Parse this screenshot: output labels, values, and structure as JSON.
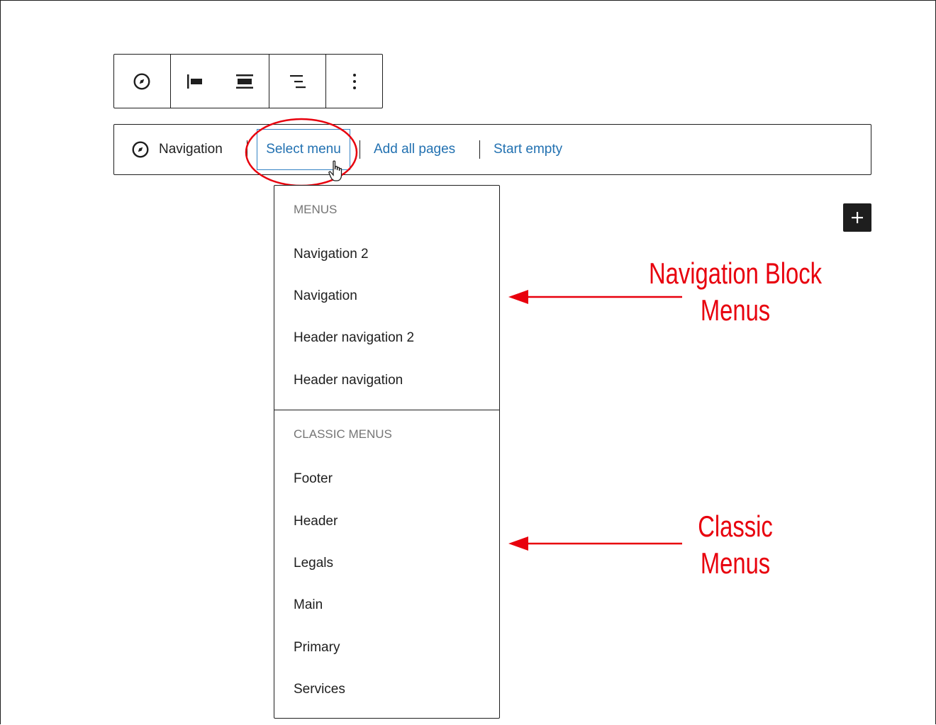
{
  "toolbar": {
    "buttons": [
      {
        "icon": "compass-icon",
        "label": "Navigation"
      },
      {
        "icon": "justify-left-icon",
        "label": "Justify items left"
      },
      {
        "icon": "justify-center-icon",
        "label": "Justify items center"
      },
      {
        "icon": "submenu-align-icon",
        "label": "Justify text"
      },
      {
        "icon": "more-options-icon",
        "label": "Options"
      }
    ]
  },
  "placeholder": {
    "block_label": "Navigation",
    "select_menu": "Select menu",
    "add_all_pages": "Add all pages",
    "start_empty": "Start empty"
  },
  "dropdown": {
    "menus_heading": "MENUS",
    "menus": [
      "Navigation 2",
      "Navigation",
      "Header navigation 2",
      "Header navigation"
    ],
    "classic_heading": "CLASSIC MENUS",
    "classic": [
      "Footer",
      "Header",
      "Legals",
      "Main",
      "Primary",
      "Services"
    ]
  },
  "annotations": {
    "nav_block_line1": "Navigation Block",
    "nav_block_line2": "Menus",
    "classic_line1": "Classic",
    "classic_line2": "Menus",
    "color": "#e8000d"
  },
  "colors": {
    "accent": "#2271b1",
    "text": "#1e1e1e",
    "muted": "#757575"
  }
}
